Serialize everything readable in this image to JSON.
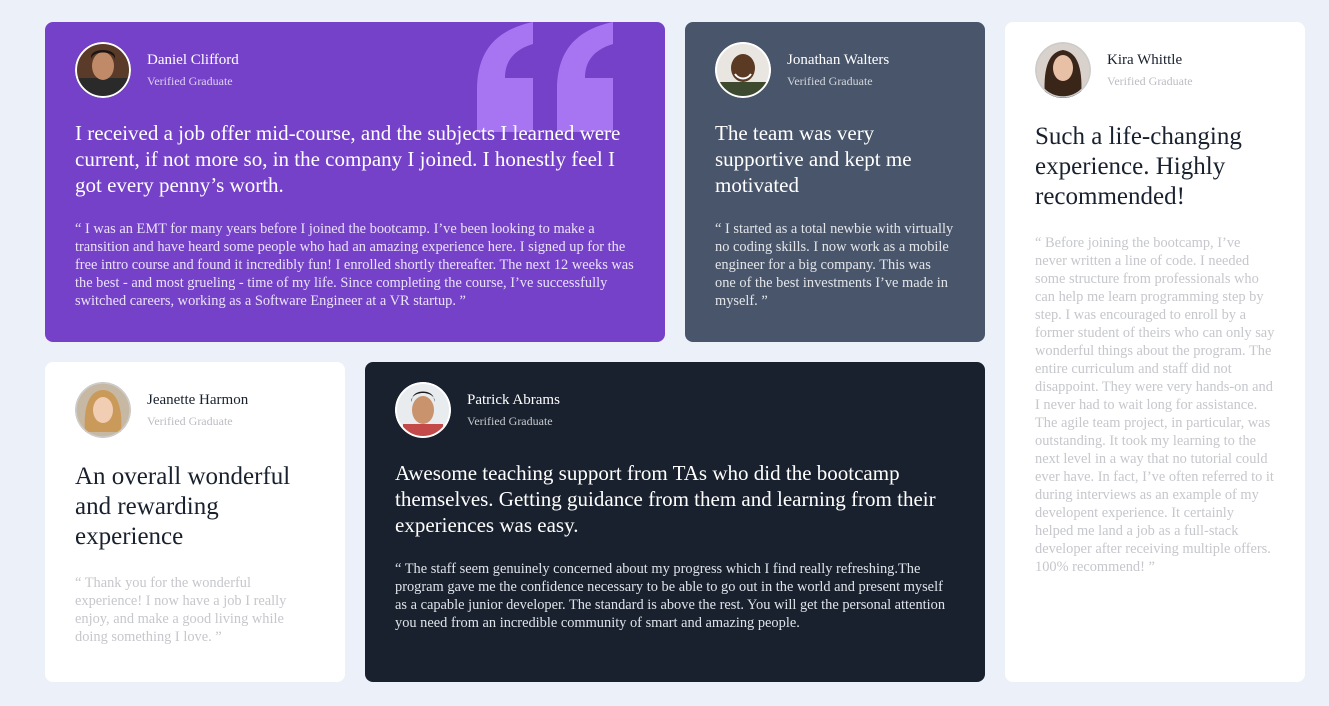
{
  "testimonials": [
    {
      "name": "Daniel Clifford",
      "role": "Verified Graduate",
      "headline": "I received a job offer mid-course, and the subjects I learned were current, if not more so, in the company I joined. I honestly feel I got every penny’s worth.",
      "body": "“ I was an EMT for many years before I joined the bootcamp. I’ve been looking to make a transition and have heard some people who had an amazing experience here. I signed up for the free intro course and found it incredibly fun! I enrolled shortly thereafter. The next 12 weeks was the best - and most grueling - time of my life. Since completing the course, I’ve successfully switched careers, working as a Software Engineer at a VR startup. ”",
      "background": "#7541c8"
    },
    {
      "name": "Jonathan Walters",
      "role": "Verified Graduate",
      "headline": "The team was very supportive and kept me motivated",
      "body": "“ I started as a total newbie with virtually no coding skills. I now work as a mobile engineer for a big company. This was one of the best investments I’ve made in myself. ”",
      "background": "#48556a"
    },
    {
      "name": "Kira Whittle",
      "role": "Verified Graduate",
      "headline": "Such a life-changing experience. Highly recommended!",
      "body": "“ Before joining the bootcamp, I’ve never written a line of code. I needed some structure from professionals who can help me learn programming step by step. I was encouraged to enroll by a former student of theirs who can only say wonderful things about the program. The entire curriculum and staff did not disappoint. They were very hands-on and I never had to wait long for assistance. The agile team project, in particular, was outstanding. It took my learning to the next level in a way that no tutorial could ever have. In fact, I’ve often referred to it during interviews as an example of my developent experience. It certainly helped me land a job as a full-stack developer after receiving multiple offers. 100% recommend! ”",
      "background": "#ffffff"
    },
    {
      "name": "Jeanette Harmon",
      "role": "Verified Graduate",
      "headline": "An overall wonderful and rewarding experience",
      "body": "“ Thank you for the wonderful experience! I now have a job I really enjoy, and make a good living while doing something I love. ”",
      "background": "#ffffff"
    },
    {
      "name": "Patrick Abrams",
      "role": "Verified Graduate",
      "headline": "Awesome teaching support from TAs who did the bootcamp themselves. Getting guidance from them and learning from their experiences was easy.",
      "body": "“ The staff seem genuinely concerned about my progress which I find really refreshing.The program gave me the confidence necessary to be able to go out in the world and present myself as a capable junior developer. The standard is above the rest. You will get the personal attention you need from an incredible community of smart and amazing people.",
      "background": "#19212e"
    }
  ],
  "colors": {
    "page_background": "#ecf0f8",
    "quote_mark": "#a775f1"
  },
  "icons": {
    "quote": "quote-icon",
    "avatar": "avatar"
  }
}
